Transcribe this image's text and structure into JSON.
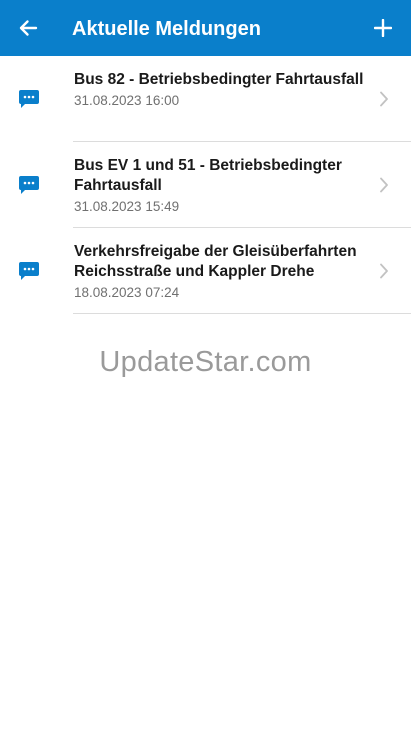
{
  "app_bar": {
    "title": "Aktuelle Meldungen",
    "back_icon": "arrow-left-icon",
    "add_icon": "plus-icon",
    "background_color": "#0a7fcb"
  },
  "messages": [
    {
      "headline": "Bus 82 - Betriebsbedingter Fahrtausfall",
      "date": "31.08.2023 16:00",
      "icon": "message-icon"
    },
    {
      "headline": "Bus EV 1 und 51 - Betriebsbedingter Fahrtausfall",
      "date": "31.08.2023 15:49",
      "icon": "message-icon"
    },
    {
      "headline": "Verkehrsfreigabe der Gleisüberfahrten Reichsstraße und Kappler Drehe",
      "date": "18.08.2023 07:24",
      "icon": "message-icon"
    }
  ],
  "watermark": "UpdateStar.com"
}
